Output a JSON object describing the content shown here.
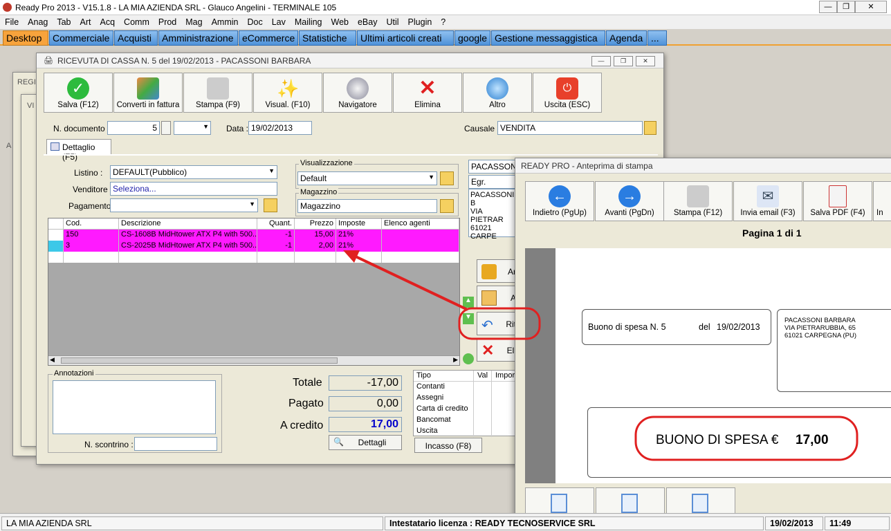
{
  "app": {
    "title": "Ready Pro 2013 - V15.1.8 - LA MIA AZIENDA SRL - Glauco Angelini - TERMINALE 105"
  },
  "menu": [
    "File",
    "Anag",
    "Tab",
    "Art",
    "Acq",
    "Comm",
    "Prod",
    "Mag",
    "Ammin",
    "Doc",
    "Lav",
    "Mailing",
    "Web",
    "eBay",
    "Util",
    "Plugin",
    "?"
  ],
  "tabs": [
    "Desktop",
    "Commerciale",
    "Acquisti",
    "Amministrazione",
    "eCommerce",
    "Statistiche",
    "Ultimi articoli creati",
    "google",
    "Gestione messaggistica",
    "Agenda",
    "..."
  ],
  "bg_windows": {
    "label_regi": "REGI",
    "label_vi": "VI",
    "label_a": "A"
  },
  "receipt": {
    "title": "RICEVUTA DI CASSA N. 5 del 19/02/2013 - PACASSONI BARBARA",
    "toolbar": [
      "Salva (F12)",
      "Converti in fattura",
      "Stampa (F9)",
      "Visual. (F10)",
      "Navigatore",
      "Elimina",
      "Altro",
      "Uscita (ESC)"
    ],
    "doc_label": "N. documento :",
    "doc_number": "5",
    "data_label": "Data :",
    "data_value": "19/02/2013",
    "causale_label": "Causale :",
    "causale_value": "VENDITA",
    "tab_label": "Dettaglio (F5)",
    "listino_label": "Listino :",
    "listino_value": "DEFAULT(Pubblico)",
    "venditore_label": "Venditore :",
    "venditore_value": "Seleziona...",
    "pagamento_label": "Pagamento :",
    "visualizzazione_label": "Visualizzazione",
    "visualizzazione_value": "Default",
    "magazzino_label": "Magazzino",
    "magazzino_value": "Magazzino",
    "customer_name": "PACASSONI",
    "customer_title": "Egr.",
    "customer_addr": [
      "PACASSONI B",
      "VIA PIETRAR",
      "61021 CARPE"
    ],
    "grid_headers": [
      "Cod.",
      "Descrizione",
      "Quant.",
      "Prezzo",
      "Imposte",
      "Elenco agenti"
    ],
    "grid_rows": [
      {
        "cod": "150",
        "desc": "CS-1608B MidHtower ATX P4 with 500...",
        "quant": "-1",
        "prezzo": "15,00",
        "imposte": "21%"
      },
      {
        "cod": "3",
        "desc": "CS-2025B MidHtower ATX P4 with 500...",
        "quant": "-1",
        "prezzo": "2,00",
        "imposte": "21%"
      }
    ],
    "side_buttons": [
      "Ar",
      "A",
      "Rit",
      "Eli"
    ],
    "annotazioni_label": "Annotazioni",
    "scontrino_label": "N. scontrino :",
    "totale_label": "Totale",
    "totale_value": "-17,00",
    "pagato_label": "Pagato",
    "pagato_value": "0,00",
    "credito_label": "A credito",
    "credito_value": "17,00",
    "dettagli_label": "Dettagli",
    "pay_headers": [
      "Tipo",
      "Val",
      "Import"
    ],
    "pay_rows": [
      "Contanti",
      "Assegni",
      "Carta di credito",
      "Bancomat",
      "Uscita"
    ],
    "incasso_label": "Incasso (F8)"
  },
  "preview": {
    "title": "READY PRO - Anteprima di stampa",
    "toolbar": [
      "Indietro (PgUp)",
      "Avanti (PgDn)",
      "Stampa (F12)",
      "Invia email (F3)",
      "Salva PDF (F4)",
      "In"
    ],
    "page_label": "Pagina 1 di 1",
    "buono_label": "Buono di spesa N. 5",
    "del_label": "del",
    "date": "19/02/2013",
    "customer": [
      "PACASSONI BARBARA",
      "VIA PIETRARUBBIA, 65",
      "61021 CARPEGNA (PU)"
    ],
    "big_label": "BUONO DI SPESA €",
    "big_value": "17,00"
  },
  "status": {
    "company": "LA MIA AZIENDA SRL",
    "license": "Intestatario licenza : READY TECNOSERVICE SRL",
    "date": "19/02/2013",
    "time": "11:49"
  },
  "colors": {
    "tab_active": "#f7a33c",
    "tab": "#4f92d9",
    "row_highlight": "#ff1aff",
    "annotation_red": "#e02020",
    "credit_blue": "#0000cc"
  }
}
